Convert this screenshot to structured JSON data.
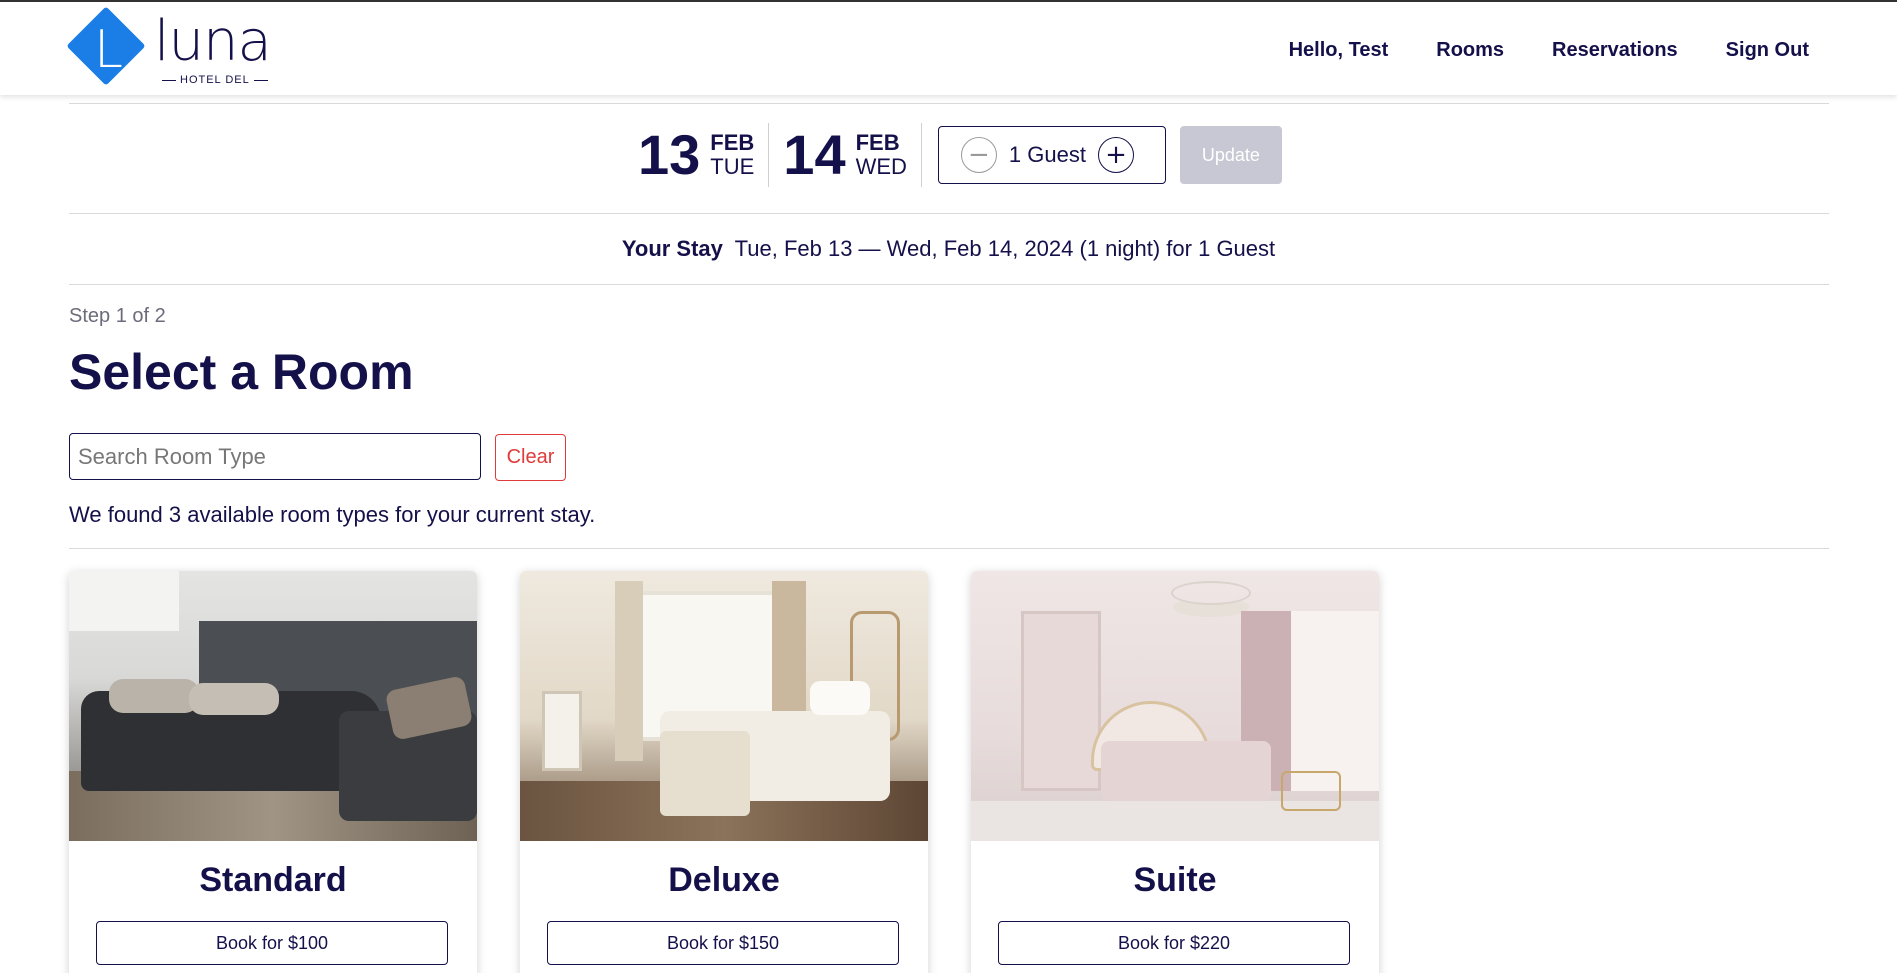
{
  "brand": {
    "logo_letter": "L",
    "name": "luna",
    "subtitle": "HOTEL DEL"
  },
  "nav": [
    {
      "label": "Hello, Test"
    },
    {
      "label": "Rooms"
    },
    {
      "label": "Reservations"
    },
    {
      "label": "Sign Out"
    }
  ],
  "booking": {
    "checkin": {
      "day": "13",
      "month": "FEB",
      "weekday": "TUE"
    },
    "checkout": {
      "day": "14",
      "month": "FEB",
      "weekday": "WED"
    },
    "guests_label": "1 Guest",
    "minus_symbol": "−",
    "plus_symbol": "+",
    "update_label": "Update"
  },
  "stay": {
    "label": "Your Stay",
    "summary": "Tue, Feb 13 — Wed, Feb 14, 2024 (1 night)  for 1 Guest"
  },
  "step_text": "Step 1 of 2",
  "page_title": "Select a Room",
  "search": {
    "placeholder": "Search Room Type",
    "value": ""
  },
  "clear_label": "Clear",
  "results_text": "We found 3 available room types for your current stay.",
  "rooms": [
    {
      "name": "Standard",
      "book_label": "Book for $100"
    },
    {
      "name": "Deluxe",
      "book_label": "Book for $150"
    },
    {
      "name": "Suite",
      "book_label": "Book for $220"
    }
  ],
  "colors": {
    "brand_blue": "#1a7ee6",
    "navy": "#14104a",
    "clear_red": "#e03b3b",
    "update_disabled": "#c8c8d4"
  }
}
